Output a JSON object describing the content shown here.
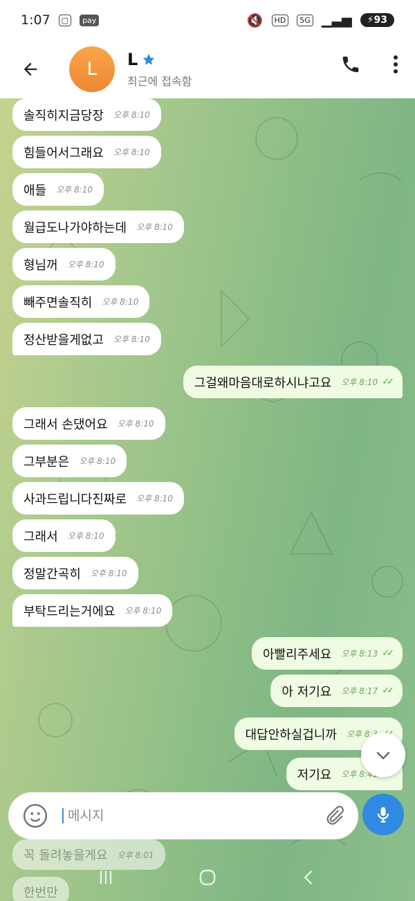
{
  "status_bar": {
    "time": "1:07",
    "pay_badge": "pay",
    "hd_badge": "HD",
    "network": "5G",
    "battery": "93"
  },
  "header": {
    "avatar_letter": "L",
    "contact_name": "L",
    "last_seen": "최근에 접속함"
  },
  "messages": [
    {
      "dir": "in",
      "text": "솔직히지금당장",
      "time": "오후 8:10"
    },
    {
      "dir": "in",
      "text": "힘들어서그래요",
      "time": "오후 8:10"
    },
    {
      "dir": "in",
      "text": "애들",
      "time": "오후 8:10"
    },
    {
      "dir": "in",
      "text": "월급도나가야하는데",
      "time": "오후 8:10"
    },
    {
      "dir": "in",
      "text": "형님꺼",
      "time": "오후 8:10"
    },
    {
      "dir": "in",
      "text": "빼주면솔직히",
      "time": "오후 8:10"
    },
    {
      "dir": "in",
      "text": "정산받을게없고",
      "time": "오후 8:10"
    },
    {
      "dir": "out",
      "text": "그걸왜마음대로하시냐고요",
      "time": "오후 8:10"
    },
    {
      "dir": "in",
      "text": "그래서 손댔어요",
      "time": "오후 8:10"
    },
    {
      "dir": "in",
      "text": "그부분은",
      "time": "오후 8:10"
    },
    {
      "dir": "in",
      "text": "사과드립니다진짜로",
      "time": "오후 8:10"
    },
    {
      "dir": "in",
      "text": "그래서",
      "time": "오후 8:10"
    },
    {
      "dir": "in",
      "text": "정말간곡히",
      "time": "오후 8:10"
    },
    {
      "dir": "in",
      "text": "부탁드리는거에요",
      "time": "오후 8:10"
    },
    {
      "dir": "out",
      "text": "아빨리주세요",
      "time": "오후 8:13"
    },
    {
      "dir": "out",
      "text": "아 저기요",
      "time": "오후 8:17"
    },
    {
      "dir": "out",
      "text": "대답안하실겁니까",
      "time": "오후 8:3"
    },
    {
      "dir": "out",
      "text": "저기요",
      "time": "오후 8:41"
    }
  ],
  "below_input": [
    {
      "text": "꼭 돌려놓을게요",
      "time": "오후 8:01"
    },
    {
      "text": "한번만"
    }
  ],
  "input": {
    "placeholder": "메시지"
  },
  "colors": {
    "accent": "#2f8ae0",
    "avatar": "#f08733",
    "outgoing_bubble": "#f0fbe3",
    "incoming_bubble": "#ffffff"
  },
  "icons": [
    "back-arrow-icon",
    "verified-star-icon",
    "phone-icon",
    "more-vert-icon",
    "chevron-down-icon",
    "emoji-icon",
    "paperclip-icon",
    "mic-icon",
    "recent-apps-icon",
    "home-icon",
    "back-nav-icon"
  ]
}
